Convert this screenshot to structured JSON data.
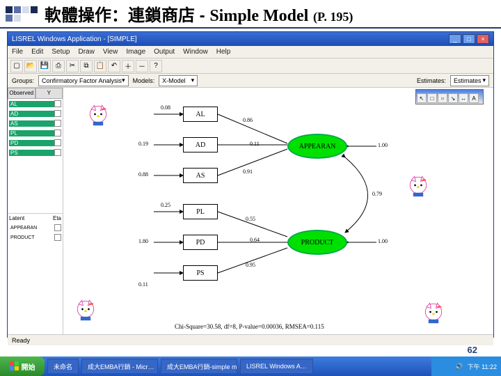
{
  "slide": {
    "title_zh": "軟體操作：連鎖商店",
    "title_dash": " - ",
    "title_en": "Simple Model",
    "title_ref": "(P. 195)",
    "page_number": "62"
  },
  "app": {
    "window_title": "LISREL Windows Application - [SIMPLE]",
    "menu": [
      "File",
      "Edit",
      "Setup",
      "Draw",
      "View",
      "Image",
      "Output",
      "Window",
      "Help"
    ],
    "toolbar_icons": [
      "new",
      "open",
      "save",
      "print",
      "cut",
      "copy",
      "paste",
      "undo",
      "zoom-in",
      "zoom-out",
      "help"
    ],
    "subbar": {
      "groups_label": "Groups:",
      "groups_value": "Confirmatory Factor Analysis",
      "models_label": "Models:",
      "models_value": "X-Model",
      "estimates_label": "Estimates:",
      "estimates_value": "Estimates"
    },
    "panel": {
      "tabs": [
        "Observed",
        "Y"
      ],
      "observed": [
        "AL",
        "AD",
        "AS",
        "PL",
        "PD",
        "PS"
      ],
      "latent_label": "Latent",
      "latent_eta": "Eta",
      "latent": [
        "APPEARAN",
        "PRODUCT"
      ]
    },
    "model": {
      "observed_nodes": [
        "AL",
        "AD",
        "AS",
        "PL",
        "PD",
        "PS"
      ],
      "latent_nodes": [
        "APPEARAN",
        "PRODUCT"
      ],
      "errors": {
        "AL": "0.08",
        "AD": "0.19",
        "AS": "0.88",
        "PL": "0.25",
        "PD": "1.80",
        "PS": "0.11"
      },
      "loadings": {
        "AL": "0.86",
        "AD": "0.11",
        "AS": "0.91",
        "PL": "0.55",
        "PD": "0.64",
        "PS": "0.95"
      },
      "latent_var": {
        "APPEARAN": "1.00",
        "PRODUCT": "1.00"
      },
      "correlation": "0.79",
      "fit": "Chi-Square=30.58, df=8, P-value=0.00036, RMSEA=0.115"
    },
    "float_tools": [
      "↖",
      "□",
      "○",
      "↘",
      "↔",
      "A"
    ],
    "status": "Ready"
  },
  "taskbar": {
    "start": "開始",
    "items": [
      "未命名",
      "成大EMBA行銷 - Micr…",
      "成大EMBA行銷-simple m…",
      "LISREL Windows A…"
    ],
    "time": "下午 11:22"
  }
}
